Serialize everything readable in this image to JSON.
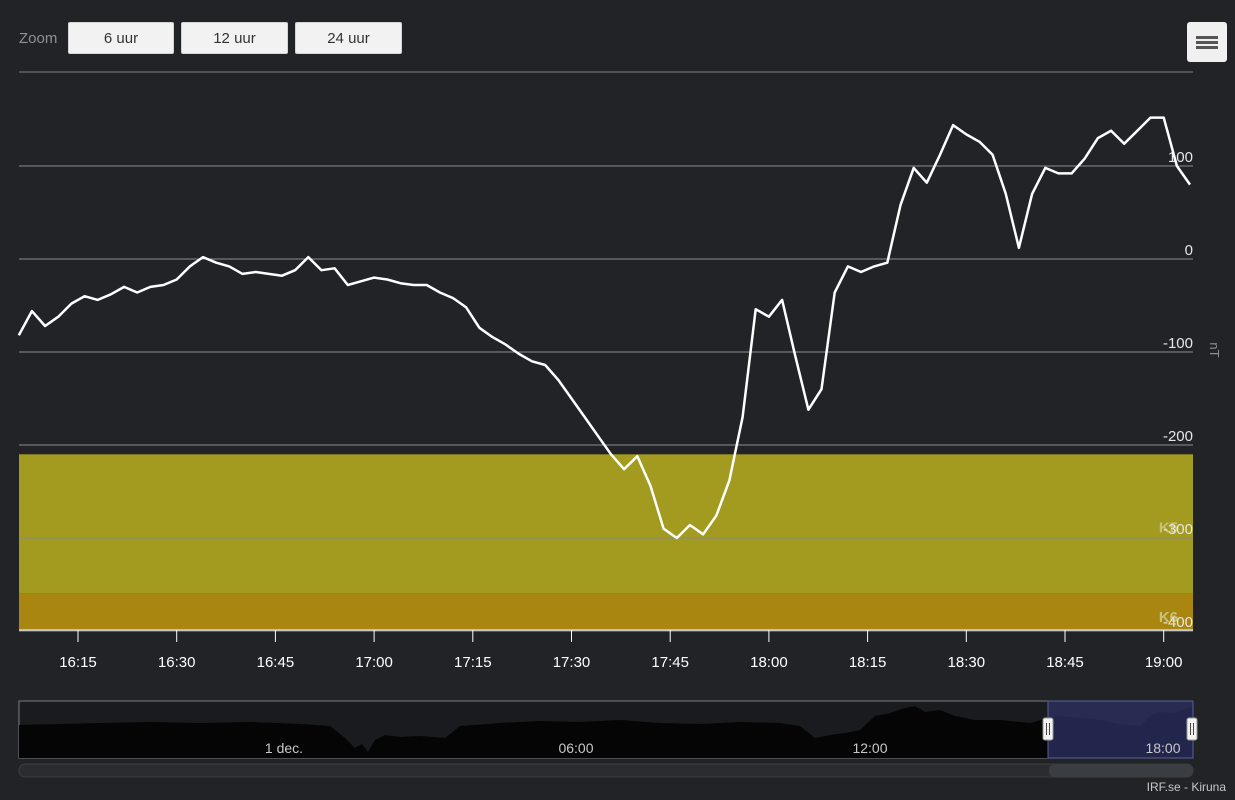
{
  "toolbar": {
    "zoom_label": "Zoom",
    "buttons": [
      "6 uur",
      "12 uur",
      "24 uur"
    ]
  },
  "credits": "IRF.se - Kiruna",
  "colors": {
    "background": "#212327",
    "band_k5": "#a39a20",
    "band_k6": "#a8860f",
    "line": "#ffffff",
    "navigator_mask": "#2d3264"
  },
  "chart_data": {
    "type": "line",
    "ylabel": "nT",
    "ylim": [
      -400,
      200
    ],
    "y_ticks": [
      {
        "value": 100,
        "label": "100"
      },
      {
        "value": 0,
        "label": "0"
      },
      {
        "value": -100,
        "label": "-100"
      },
      {
        "value": -200,
        "label": "-200"
      },
      {
        "value": -300,
        "label": "-300"
      },
      {
        "value": -400,
        "label": "-400"
      }
    ],
    "x_ticks": [
      "16:15",
      "16:30",
      "16:45",
      "17:00",
      "17:15",
      "17:30",
      "17:45",
      "18:00",
      "18:15",
      "18:30",
      "18:45",
      "19:00"
    ],
    "plot_bands": [
      {
        "label": "K5",
        "from": -210,
        "to": -360
      },
      {
        "label": "K6",
        "from": -360,
        "to": -400
      }
    ],
    "x": [
      "16:06",
      "16:08",
      "16:10",
      "16:12",
      "16:14",
      "16:16",
      "16:18",
      "16:20",
      "16:22",
      "16:24",
      "16:26",
      "16:28",
      "16:30",
      "16:32",
      "16:34",
      "16:36",
      "16:38",
      "16:40",
      "16:42",
      "16:44",
      "16:46",
      "16:48",
      "16:50",
      "16:52",
      "16:54",
      "16:56",
      "16:58",
      "17:00",
      "17:02",
      "17:04",
      "17:06",
      "17:08",
      "17:10",
      "17:12",
      "17:14",
      "17:16",
      "17:18",
      "17:20",
      "17:22",
      "17:24",
      "17:26",
      "17:28",
      "17:30",
      "17:32",
      "17:34",
      "17:36",
      "17:38",
      "17:40",
      "17:42",
      "17:44",
      "17:46",
      "17:48",
      "17:50",
      "17:52",
      "17:54",
      "17:56",
      "17:58",
      "18:00",
      "18:02",
      "18:04",
      "18:06",
      "18:08",
      "18:10",
      "18:12",
      "18:14",
      "18:16",
      "18:18",
      "18:20",
      "18:22",
      "18:24",
      "18:26",
      "18:28",
      "18:30",
      "18:32",
      "18:34",
      "18:36",
      "18:38",
      "18:40",
      "18:42",
      "18:44",
      "18:46",
      "18:48",
      "18:50",
      "18:52",
      "18:54",
      "18:56",
      "18:58",
      "19:00",
      "19:02",
      "19:04"
    ],
    "series": [
      {
        "values": [
          -82,
          -56,
          -72,
          -62,
          -48,
          -40,
          -44,
          -38,
          -30,
          -36,
          -30,
          -28,
          -22,
          -8,
          2,
          -4,
          -8,
          -16,
          -14,
          -16,
          -18,
          -12,
          2,
          -12,
          -10,
          -28,
          -24,
          -20,
          -22,
          -26,
          -28,
          -28,
          -36,
          -42,
          -52,
          -74,
          -84,
          -92,
          -102,
          -110,
          -114,
          -130,
          -150,
          -170,
          -190,
          -210,
          -226,
          -212,
          -244,
          -290,
          -300,
          -286,
          -296,
          -276,
          -238,
          -170,
          -54,
          -62,
          -44,
          -104,
          -162,
          -140,
          -36,
          -8,
          -14,
          -8,
          -4,
          58,
          98,
          82,
          112,
          144,
          134,
          126,
          112,
          70,
          12,
          70,
          98,
          92,
          92,
          108,
          130,
          138,
          124,
          138,
          152,
          152,
          100,
          80,
          90
        ]
      }
    ]
  },
  "navigator": {
    "labels": [
      "1 dec.",
      "06:00",
      "12:00",
      "18:00"
    ]
  }
}
